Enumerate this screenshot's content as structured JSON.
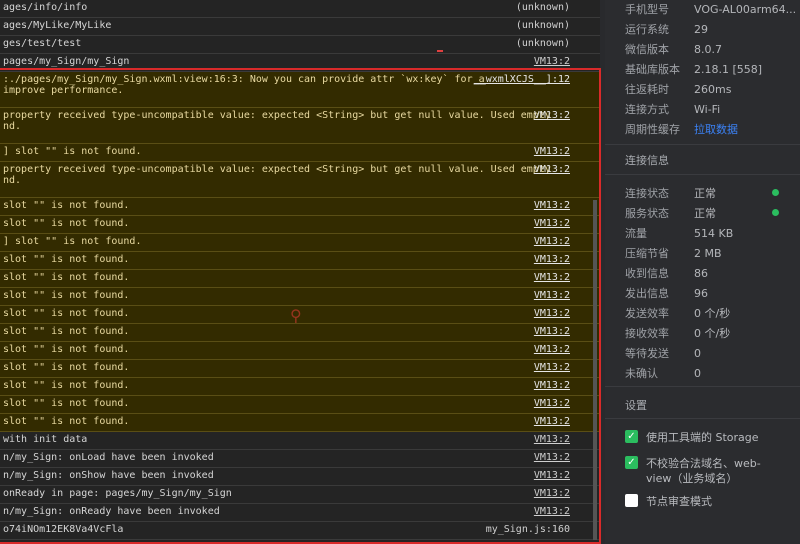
{
  "console": {
    "rows": [
      {
        "msg": "ages/info/info",
        "src": "(unknown)",
        "type": "log",
        "plain": true
      },
      {
        "msg": "ages/MyLike/MyLike",
        "src": "(unknown)",
        "type": "log",
        "plain": true
      },
      {
        "msg": "ges/test/test",
        "src": "(unknown)",
        "type": "log",
        "plain": true
      },
      {
        "msg": "  pages/my_Sign/my_Sign",
        "src": "VM13:2",
        "type": "log"
      },
      {
        "msg": ":./pages/my_Sign/my_Sign.wxml:view:16:3: Now you can provide attr `wx:key` for a",
        "msg2": "improve performance.",
        "src": "__wxmlXCJS__]:12",
        "type": "warn"
      },
      {
        "msg": " property received type-uncompatible value: expected <String> but get null value. Used empty",
        "msg2": "nd.",
        "src": "VM13:2",
        "type": "warn"
      },
      {
        "msg": "] slot \"\" is not found.",
        "src": "VM13:2",
        "type": "warn"
      },
      {
        "msg": " property received type-uncompatible value: expected <String> but get null value. Used empty",
        "msg2": "nd.",
        "src": "VM13:2",
        "type": "warn"
      },
      {
        "msg": " slot \"\" is not found.",
        "src": "VM13:2",
        "type": "warn"
      },
      {
        "msg": " slot \"\" is not found.",
        "src": "VM13:2",
        "type": "warn"
      },
      {
        "msg": "] slot \"\" is not found.",
        "src": "VM13:2",
        "type": "warn"
      },
      {
        "msg": " slot \"\" is not found.",
        "src": "VM13:2",
        "type": "warn"
      },
      {
        "msg": " slot \"\" is not found.",
        "src": "VM13:2",
        "type": "warn"
      },
      {
        "msg": " slot \"\" is not found.",
        "src": "VM13:2",
        "type": "warn"
      },
      {
        "msg": " slot \"\" is not found.",
        "src": "VM13:2",
        "type": "warn"
      },
      {
        "msg": " slot \"\" is not found.",
        "src": "VM13:2",
        "type": "warn"
      },
      {
        "msg": " slot \"\" is not found.",
        "src": "VM13:2",
        "type": "warn"
      },
      {
        "msg": " slot \"\" is not found.",
        "src": "VM13:2",
        "type": "warn"
      },
      {
        "msg": " slot \"\" is not found.",
        "src": "VM13:2",
        "type": "warn"
      },
      {
        "msg": " slot \"\" is not found.",
        "src": "VM13:2",
        "type": "warn"
      },
      {
        "msg": " slot \"\" is not found.",
        "src": "VM13:2",
        "type": "warn"
      },
      {
        "msg": "with init data",
        "src": "VM13:2",
        "type": "log"
      },
      {
        "msg": "n/my_Sign: onLoad have been invoked",
        "src": "VM13:2",
        "type": "log"
      },
      {
        "msg": "n/my_Sign: onShow have been invoked",
        "src": "VM13:2",
        "type": "log"
      },
      {
        "msg": " onReady in page: pages/my_Sign/my_Sign",
        "src": "VM13:2",
        "type": "log"
      },
      {
        "msg": "n/my_Sign: onReady have been invoked",
        "src": "VM13:2",
        "type": "log"
      },
      {
        "msg": "o74iNOm12EK8Va4VcFla",
        "src": "my_Sign.js:160",
        "type": "log",
        "plain": true
      }
    ]
  },
  "panel": {
    "info": [
      {
        "k": "手机型号",
        "v": "VOG-AL00arm64..."
      },
      {
        "k": "运行系统",
        "v": "29"
      },
      {
        "k": "微信版本",
        "v": "8.0.7"
      },
      {
        "k": "基础库版本",
        "v": "2.18.1 [558]"
      },
      {
        "k": "往返耗时",
        "v": "260ms"
      },
      {
        "k": "连接方式",
        "v": "Wi-Fi"
      },
      {
        "k": "周期性缓存",
        "v": "拉取数据"
      }
    ],
    "conn_title": "连接信息",
    "conn": [
      {
        "k": "连接状态",
        "v": "正常",
        "dot": true
      },
      {
        "k": "服务状态",
        "v": "正常",
        "dot": true
      },
      {
        "k": "流量",
        "v": "514 KB"
      },
      {
        "k": "压缩节省",
        "v": "2 MB"
      },
      {
        "k": "收到信息",
        "v": "86"
      },
      {
        "k": "发出信息",
        "v": "96"
      },
      {
        "k": "发送效率",
        "v": "0 个/秒"
      },
      {
        "k": "接收效率",
        "v": "0 个/秒"
      },
      {
        "k": "等待发送",
        "v": "0"
      },
      {
        "k": "未确认",
        "v": "0"
      }
    ],
    "settings_title": "设置",
    "settings": [
      {
        "label": "使用工具端的 Storage",
        "checked": true
      },
      {
        "label": "不校验合法域名、web-view（业务域名）",
        "checked": true
      },
      {
        "label": "节点审查模式",
        "checked": false
      }
    ],
    "link_color": "#3b82f6",
    "status_color": "#2bbd5f"
  }
}
